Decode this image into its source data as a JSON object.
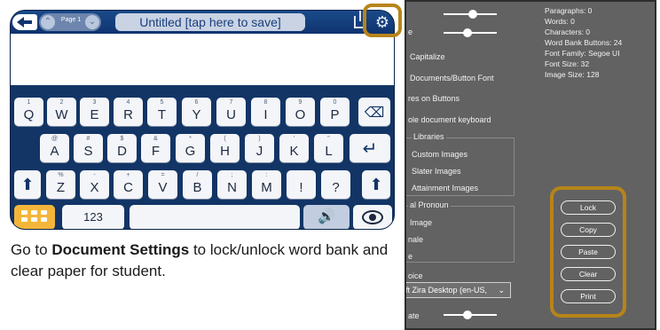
{
  "app": {
    "page_label": "Page 1",
    "document_title": "Untitled  [tap here to save]"
  },
  "keyboard": {
    "row1": [
      {
        "sub": "1",
        "main": "Q"
      },
      {
        "sub": "2",
        "main": "W"
      },
      {
        "sub": "3",
        "main": "E"
      },
      {
        "sub": "4",
        "main": "R"
      },
      {
        "sub": "5",
        "main": "T"
      },
      {
        "sub": "6",
        "main": "Y"
      },
      {
        "sub": "7",
        "main": "U"
      },
      {
        "sub": "8",
        "main": "I"
      },
      {
        "sub": "9",
        "main": "O"
      },
      {
        "sub": "0",
        "main": "P"
      }
    ],
    "row2": [
      {
        "sub": "@",
        "main": "A"
      },
      {
        "sub": "#",
        "main": "S"
      },
      {
        "sub": "$",
        "main": "D"
      },
      {
        "sub": "&",
        "main": "F"
      },
      {
        "sub": "*",
        "main": "G"
      },
      {
        "sub": "(",
        "main": "H"
      },
      {
        "sub": ")",
        "main": "J"
      },
      {
        "sub": "'",
        "main": "K"
      },
      {
        "sub": "\"",
        "main": "L"
      }
    ],
    "row3": [
      {
        "sub": "%",
        "main": "Z"
      },
      {
        "sub": "-",
        "main": "X"
      },
      {
        "sub": "+",
        "main": "C"
      },
      {
        "sub": "=",
        "main": "V"
      },
      {
        "sub": "/",
        "main": "B"
      },
      {
        "sub": ";",
        "main": "N"
      },
      {
        "sub": ":",
        "main": "M"
      },
      {
        "sub": "",
        "main": "!"
      },
      {
        "sub": "",
        "main": "?"
      }
    ],
    "numbers_label": "123"
  },
  "caption": {
    "before": "Go to ",
    "bold": "Document Settings",
    "after": " to lock/unlock word bank and clear paper for student."
  },
  "settings": {
    "labels": [
      {
        "key": "capitalize",
        "text": "Capitalize"
      },
      {
        "key": "font",
        "text": "Documents/Button Font"
      },
      {
        "key": "buttons",
        "text": "res on Buttons"
      },
      {
        "key": "keyboard",
        "text": "ole document keyboard"
      },
      {
        "key": "libraries",
        "text": "Libraries"
      },
      {
        "key": "custom",
        "text": "Custom Images"
      },
      {
        "key": "slater",
        "text": "Slater Images"
      },
      {
        "key": "attainment",
        "text": "Attainment Images"
      },
      {
        "key": "pronoun",
        "text": "al Pronoun"
      },
      {
        "key": "image",
        "text": "Image"
      },
      {
        "key": "male",
        "text": "nale"
      },
      {
        "key": "e",
        "text": "e"
      },
      {
        "key": "voice",
        "text": "oice"
      },
      {
        "key": "rate",
        "text": "ate"
      },
      {
        "key": "top_e",
        "text": "e"
      }
    ],
    "voice_select": "ft Zira Desktop (en-US,",
    "stats": [
      "Paragraphs: 0",
      "Words: 0",
      "Characters: 0",
      "Word Bank Buttons: 24",
      "Font Family: Segoe UI",
      "Font Size: 32",
      "Image Size: 128"
    ],
    "actions": [
      "Lock",
      "Copy",
      "Paste",
      "Clear",
      "Print"
    ],
    "slider_levels": {
      "top": 0.55,
      "middle": 0.45,
      "rate": 0.45
    }
  },
  "colors": {
    "highlight": "#b78419",
    "keyboard_bg": "#123566",
    "panel_bg": "#626262",
    "grid_button": "#f4b63a"
  }
}
